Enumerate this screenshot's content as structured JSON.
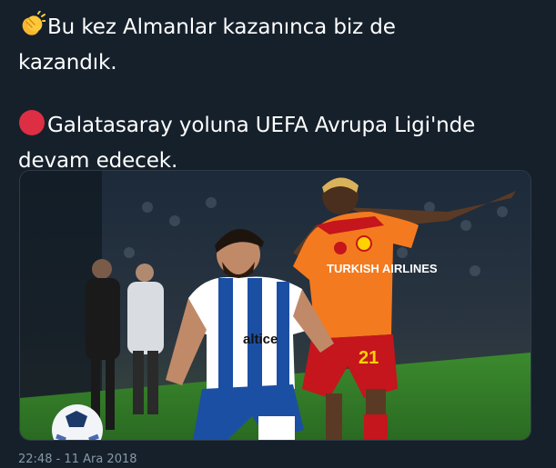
{
  "tweet": {
    "paragraphs": [
      {
        "emoji": "clapping-hands-icon",
        "lines": [
          "Bu kez Almanlar kazanınca biz de",
          "kazandık."
        ]
      },
      {
        "emoji": "red-circle-icon",
        "lines": [
          "Galatasaray yoluna UEFA Avrupa Ligi'nde",
          "devam edecek."
        ]
      }
    ],
    "timestamp": "22:48 - 11 Ara 2018"
  },
  "media": {
    "left_shirt_sponsor": "altice",
    "right_shirt_sponsor": "TURKISH AIRLINES",
    "right_shirt_number": "21"
  },
  "colors": {
    "background": "#15202b",
    "text": "#ffffff",
    "muted": "#8899a6",
    "porto_blue": "#1b4fa3",
    "gala_orange": "#f47a1f",
    "gala_red": "#c4161c",
    "pitch": "#2f7a2a"
  }
}
